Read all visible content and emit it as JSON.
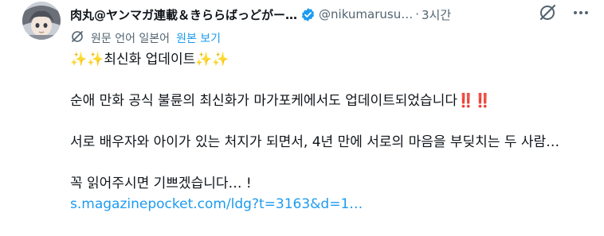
{
  "author": {
    "display_name": "肉丸@ヤンマガ連載＆きららばっどがー…",
    "handle": "@nikumarusu…",
    "time_sep": "·",
    "time": "3시간",
    "verified": true
  },
  "translation": {
    "label": "원문 언어 일본어",
    "show_original": "원본 보기"
  },
  "tweet": {
    "line1": "✨✨최신화 업데이트✨✨",
    "line2": "순애 만화 공식 불륜의 최신화가 마가포케에서도 업데이트되었습니다‼️‼️",
    "line3": "서로 배우자와 아이가 있는 처지가 되면서, 4년 만에 서로의 마음을 부딪치는 두 사람…",
    "line4": "꼭 읽어주시면 기쁘겠습니다… !",
    "link": "s.magazinepocket.com/ldg?t=3163&d=1…"
  },
  "colors": {
    "accent": "#1d9bf0",
    "secondary_text": "#536471",
    "primary_text": "#0f1419"
  },
  "icons": {
    "verified": "verified-badge-icon",
    "grok": "grok-icon",
    "more": "more-options-icon",
    "translate": "translate-icon"
  }
}
